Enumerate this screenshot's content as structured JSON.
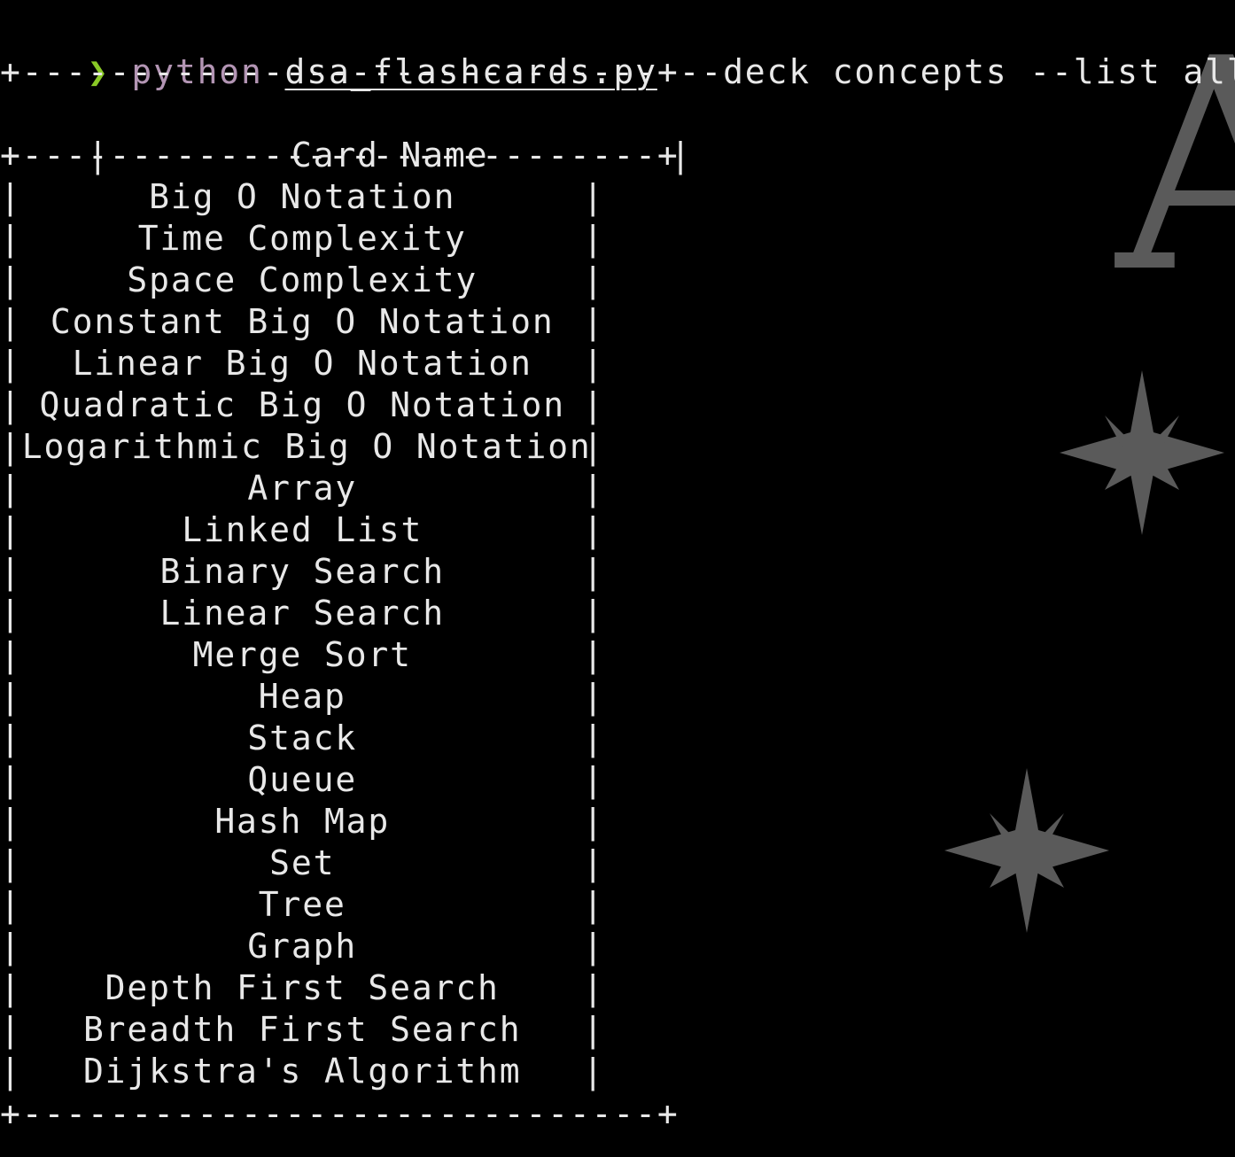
{
  "command": {
    "prompt_glyph": "❯",
    "program": "python",
    "file": "dsa_flashcards.py",
    "args": "--deck concepts --list all"
  },
  "table": {
    "border": "+-----------------------------+",
    "vertical_char": "|",
    "header": "Card Name",
    "rows": [
      "Big O Notation",
      "Time Complexity",
      "Space Complexity",
      "Constant Big O Notation",
      "Linear Big O Notation",
      "Quadratic Big O Notation",
      "Logarithmic Big O Notation",
      "Array",
      "Linked List",
      "Binary Search",
      "Linear Search",
      "Merge Sort",
      "Heap",
      "Stack",
      "Queue",
      "Hash Map",
      "Set",
      "Tree",
      "Graph",
      "Depth First Search",
      "Breadth First Search",
      "Dijkstra's Algorithm"
    ]
  },
  "background_decorations": {
    "icons": [
      "letter-a-glyph",
      "four-point-star-icon",
      "four-point-star-icon"
    ],
    "letter": "A",
    "color": "#5a5a5a"
  },
  "colors": {
    "background": "#000000",
    "text": "#e8e8e8",
    "prompt_caret": "#8ac926",
    "command_name": "#b395b4"
  }
}
